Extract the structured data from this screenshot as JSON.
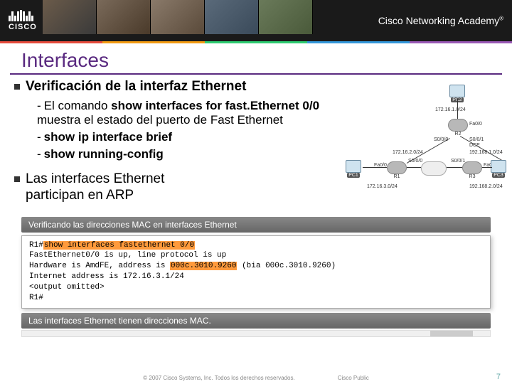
{
  "header": {
    "brand": "CISCO",
    "program": "Cisco Networking Academy",
    "reg": "®"
  },
  "title": "Interfaces",
  "section": {
    "heading": "Verificación de la interfaz Ethernet",
    "items": [
      {
        "pre": "El comando ",
        "cmd": "show interfaces for fast.Ethernet 0/0",
        "post": " muestra el estado del puerto de Fast Ethernet"
      },
      {
        "pre": "",
        "cmd": "show ip interface brief",
        "post": ""
      },
      {
        "pre": "",
        "cmd": "show running-config",
        "post": ""
      }
    ],
    "arp": "Las interfaces Ethernet participan en ARP"
  },
  "diagram": {
    "pcs": [
      "PC1",
      "PC2",
      "PC3"
    ],
    "routers": [
      "R1",
      "R2",
      "R3"
    ],
    "nets": [
      "172.16.1.0/24",
      "172.16.2.0/24",
      "172.16.3.0/24",
      "192.168.1.0/24",
      "192.168.2.0/24"
    ],
    "iface_labels": [
      "Fa0/0",
      "S0/0/0",
      "S0/0/1",
      "DCE"
    ],
    "cloud": "WAN"
  },
  "captions": {
    "top": "Verificando las direcciones MAC en interfaces Ethernet",
    "bottom": "Las interfaces Ethernet tienen direcciones MAC."
  },
  "terminal": {
    "prompt1": "R1#",
    "cmd1": "show interfaces fastethernet 0/0",
    "line2a": "FastEthernet0/0 is up, line protocol is up",
    "line3a": "  Hardware is AmdFE, address is ",
    "mac1": "000c.3010.9260",
    "line3b": " (bia 000c.3010.9260)",
    "line4": "  Internet address is 172.16.3.1/24",
    "line5": "  <output omitted>",
    "prompt2": "R1#"
  },
  "footer": {
    "copyright": "© 2007 Cisco Systems, Inc. Todos los derechos reservados.",
    "classification": "Cisco Public",
    "page": "7"
  }
}
